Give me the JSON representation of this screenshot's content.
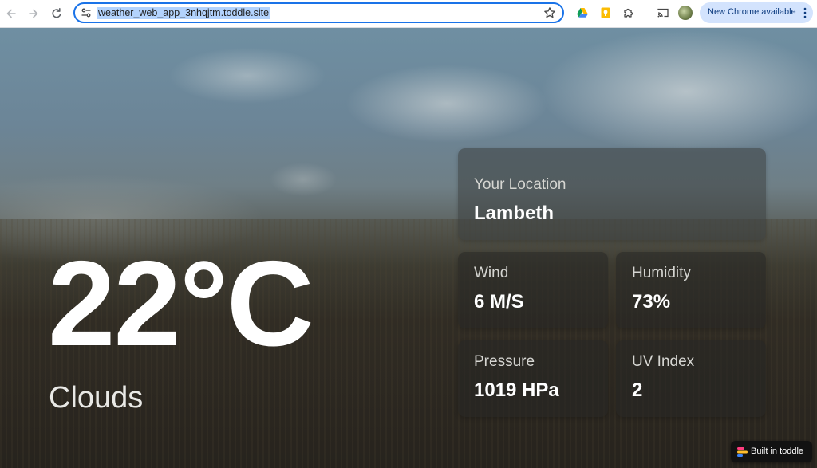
{
  "browser": {
    "url": "weather_web_app_3nhqjtm.toddle.site",
    "update_label": "New Chrome available",
    "icons": {
      "back": "back-arrow-icon",
      "forward": "forward-arrow-icon",
      "reload": "reload-icon",
      "site_info": "tune-icon",
      "bookmark": "star-icon",
      "drive": "google-drive-icon",
      "keep": "google-keep-icon",
      "extensions": "puzzle-icon",
      "cast": "cast-icon",
      "menu": "kebab-menu-icon"
    }
  },
  "weather": {
    "temperature": "22°C",
    "condition": "Clouds",
    "location_label": "Your Location",
    "location": "Lambeth",
    "stats": [
      {
        "label": "Wind",
        "value": "6 M/S"
      },
      {
        "label": "Humidity",
        "value": "73%"
      },
      {
        "label": "Pressure",
        "value": "1019 HPa"
      },
      {
        "label": "UV Index",
        "value": "2"
      }
    ]
  },
  "badge": {
    "label": "Built in toddle",
    "colors": [
      "#ff3d7f",
      "#ffbe2e",
      "#3b82f6"
    ]
  }
}
